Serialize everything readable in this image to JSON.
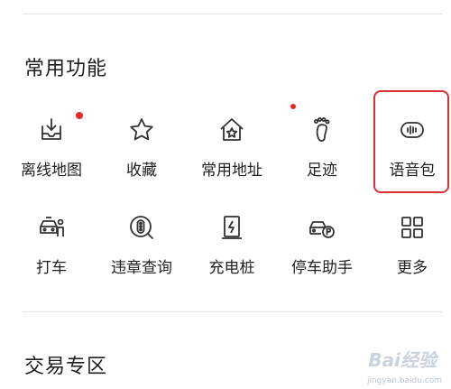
{
  "sections": {
    "common_title": "常用功能",
    "trade_title": "交易专区"
  },
  "items": [
    {
      "label": "离线地图",
      "icon": "download-tray-icon",
      "badge": true
    },
    {
      "label": "收藏",
      "icon": "star-icon",
      "badge": false
    },
    {
      "label": "常用地址",
      "icon": "home-star-icon",
      "badge": false
    },
    {
      "label": "足迹",
      "icon": "footprint-icon",
      "badge": true
    },
    {
      "label": "语音包",
      "icon": "voice-wave-icon",
      "badge": false,
      "highlighted": true
    },
    {
      "label": "打车",
      "icon": "taxi-person-icon",
      "badge": false
    },
    {
      "label": "违章查询",
      "icon": "traffic-light-search-icon",
      "badge": false
    },
    {
      "label": "充电桩",
      "icon": "charging-pile-icon",
      "badge": false
    },
    {
      "label": "停车助手",
      "icon": "car-parking-icon",
      "badge": false
    },
    {
      "label": "更多",
      "icon": "grid-more-icon",
      "badge": false
    }
  ],
  "watermark": {
    "logo_text": "Bai经验",
    "url_text": "jingyan.baidu.com"
  },
  "colors": {
    "badge": "#e52a2a",
    "highlight_border": "#d9302e",
    "divider": "#e3e3e3",
    "icon_stroke": "#333333"
  }
}
